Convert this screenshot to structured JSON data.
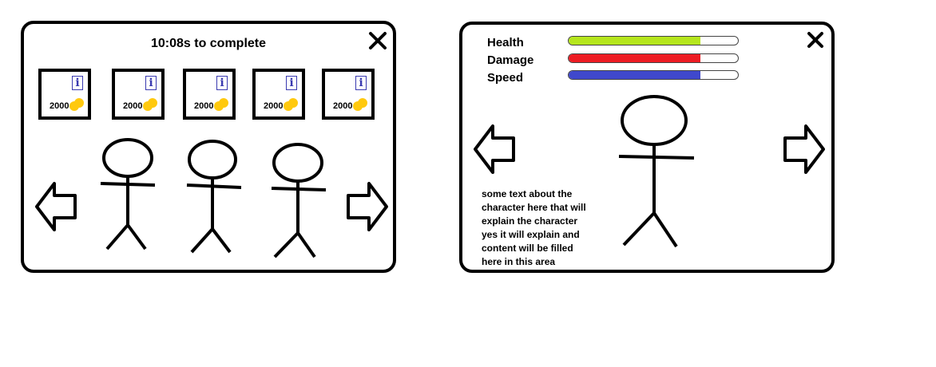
{
  "shop": {
    "timer": "10:08s to complete",
    "cards": [
      {
        "price": "2000",
        "info_label": "i"
      },
      {
        "price": "2000",
        "info_label": "i"
      },
      {
        "price": "2000",
        "info_label": "i"
      },
      {
        "price": "2000",
        "info_label": "i"
      },
      {
        "price": "2000",
        "info_label": "i"
      }
    ],
    "icons": {
      "close": "close-icon",
      "coin": "coin-icon",
      "info": "info-icon",
      "left": "arrow-left-icon",
      "right": "arrow-right-icon"
    }
  },
  "character": {
    "stats": [
      {
        "label": "Health",
        "level": 0.78,
        "color": "#b5e61d"
      },
      {
        "label": "Damage",
        "level": 0.78,
        "color": "#ed1c24"
      },
      {
        "label": "Speed",
        "level": 0.78,
        "color": "#3f48cc"
      }
    ],
    "description_lines": [
      "some text about the",
      "character here that will",
      "explain the character",
      "yes it will explain and",
      "content will be filled",
      "here in this  area"
    ]
  },
  "colors": {
    "coin": "#ffc90e",
    "info": "#3a3ab0"
  }
}
